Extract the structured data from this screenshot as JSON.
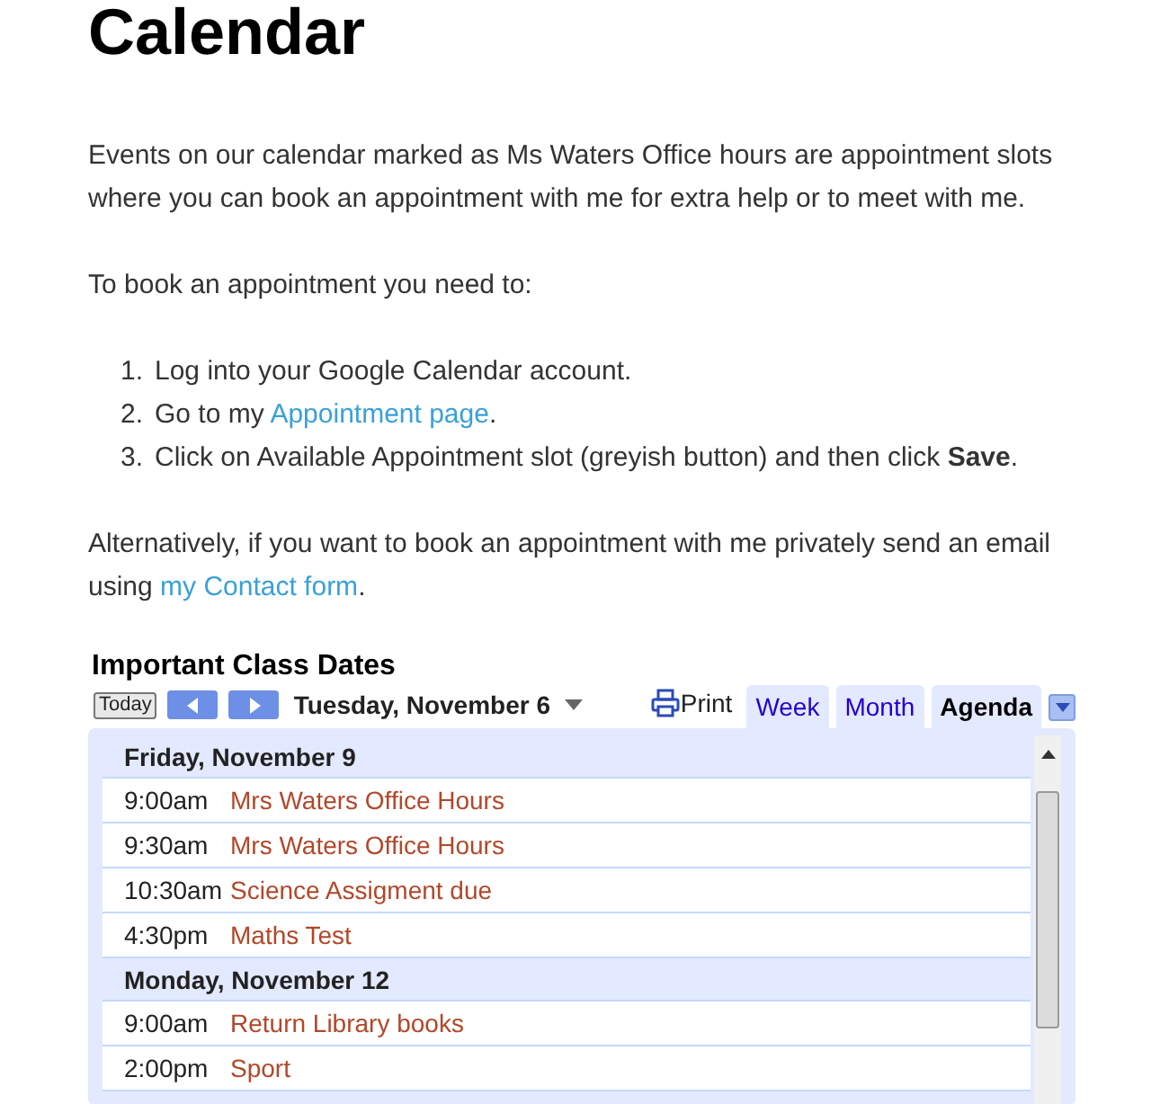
{
  "heading": "Calendar",
  "intro": "Events on our calendar marked as Ms Waters Office hours are appointment slots where you can book an appointment with me for extra help or to meet with me.",
  "lead": "To book an appointment you need to:",
  "steps": [
    {
      "number": "1.",
      "text": "Log into your Google Calendar account."
    },
    {
      "number": "2.",
      "text": "Go to my ",
      "link": "Appointment page",
      "after": "."
    },
    {
      "number": "3.",
      "text": "Click on Available Appointment slot (greyish button) and then click **Save**."
    }
  ],
  "alternative": {
    "text": "Alternatively, if you want to book an appointment with me privately send an email using ",
    "link": "my Contact form",
    "after": "."
  },
  "calendar": {
    "title": "Important Class Dates",
    "today": "Today",
    "date": "Tuesday, November 6",
    "print": "Print",
    "tabs": [
      {
        "label": "Week",
        "selected": false
      },
      {
        "label": "Month",
        "selected": false
      },
      {
        "label": "Agenda",
        "selected": true
      }
    ],
    "days": [
      {
        "date": "Friday, November 9",
        "events": [
          {
            "time": "9:00am",
            "title": "Mrs Waters Office Hours"
          },
          {
            "time": "9:30am",
            "title": "Mrs Waters Office Hours"
          },
          {
            "time": "10:30am",
            "title": "Science Assigment due"
          },
          {
            "time": "4:30pm",
            "title": "Maths Test"
          }
        ]
      },
      {
        "date": "Monday, November 12",
        "events": [
          {
            "time": "9:00am",
            "title": "Return Library books"
          },
          {
            "time": "2:00pm",
            "title": "Sport"
          }
        ]
      }
    ]
  }
}
